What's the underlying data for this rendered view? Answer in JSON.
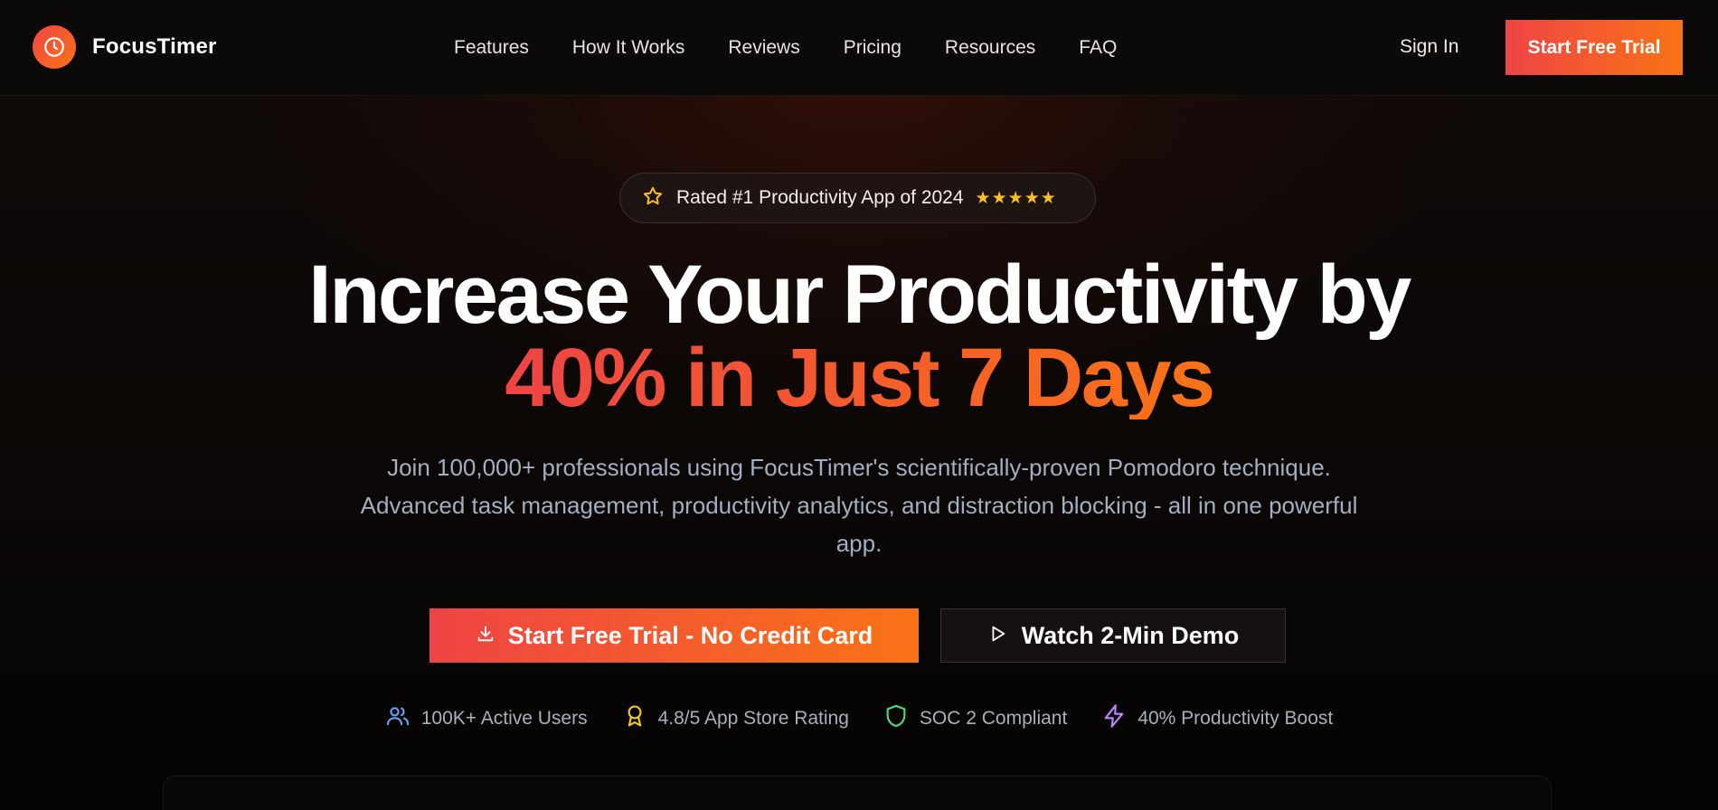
{
  "nav": {
    "brand": "FocusTimer",
    "links": [
      "Features",
      "How It Works",
      "Reviews",
      "Pricing",
      "Resources",
      "FAQ"
    ],
    "sign_in": "Sign In",
    "cta": "Start Free Trial"
  },
  "hero": {
    "badge": "Rated #1 Productivity App of 2024",
    "rating_stars": 5,
    "headline_line1": "Increase Your Productivity by",
    "headline_line2": "40% in Just 7 Days",
    "subcopy": "Join 100,000+ professionals using FocusTimer's scientifically-proven Pomodoro technique. Advanced task management, productivity analytics, and distraction blocking - all in one powerful app.",
    "cta_primary": "Start Free Trial - No Credit Card",
    "cta_secondary": "Watch 2-Min Demo"
  },
  "trust": [
    {
      "icon": "users-icon",
      "label": "100K+ Active Users",
      "color": "#60a5fa"
    },
    {
      "icon": "award-icon",
      "label": "4.8/5 App Store Rating",
      "color": "#facc15"
    },
    {
      "icon": "shield-icon",
      "label": "SOC 2 Compliant",
      "color": "#4ade80"
    },
    {
      "icon": "zap-icon",
      "label": "40% Productivity Boost",
      "color": "#c084fc"
    }
  ],
  "colors": {
    "accent_start": "#ef4444",
    "accent_end": "#f97316",
    "background": "#0b0807",
    "star": "#fbbf24"
  }
}
